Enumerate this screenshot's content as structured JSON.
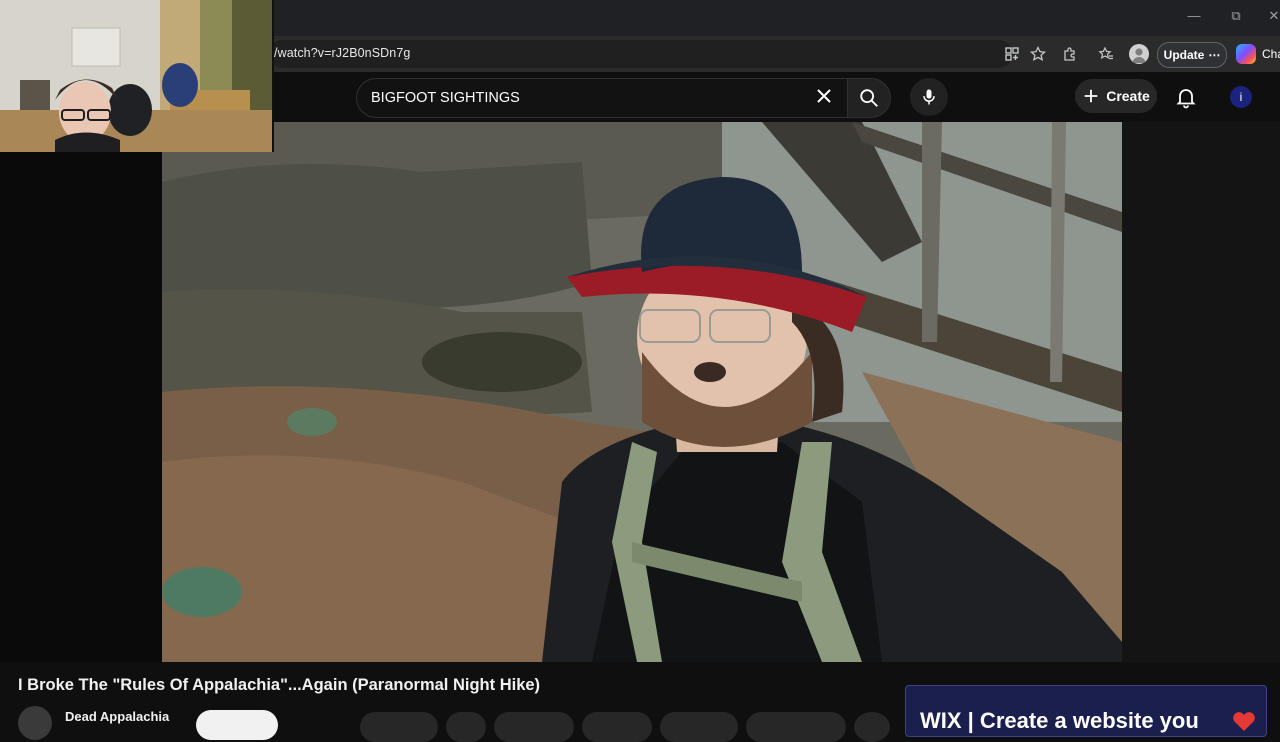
{
  "browser": {
    "url": "/watch?v=rJ2B0nSDn7g",
    "update_label": "Update",
    "update_more": "⋯",
    "chat_label": "Cha"
  },
  "youtube": {
    "search_query": "BIGFOOT SIGHTINGS",
    "create_label": "Create",
    "avatar_initial": "i"
  },
  "video": {
    "title": "I Broke The \"Rules Of Appalachia\"...Again (Paranormal Night Hike)",
    "channel": "Dead Appalachia"
  },
  "ad": {
    "text": "WIX | Create a website you"
  },
  "colors": {
    "background": "#0f0f0f",
    "accent_wix": "#1b1f4d",
    "hat_brim": "#9b1b26"
  }
}
